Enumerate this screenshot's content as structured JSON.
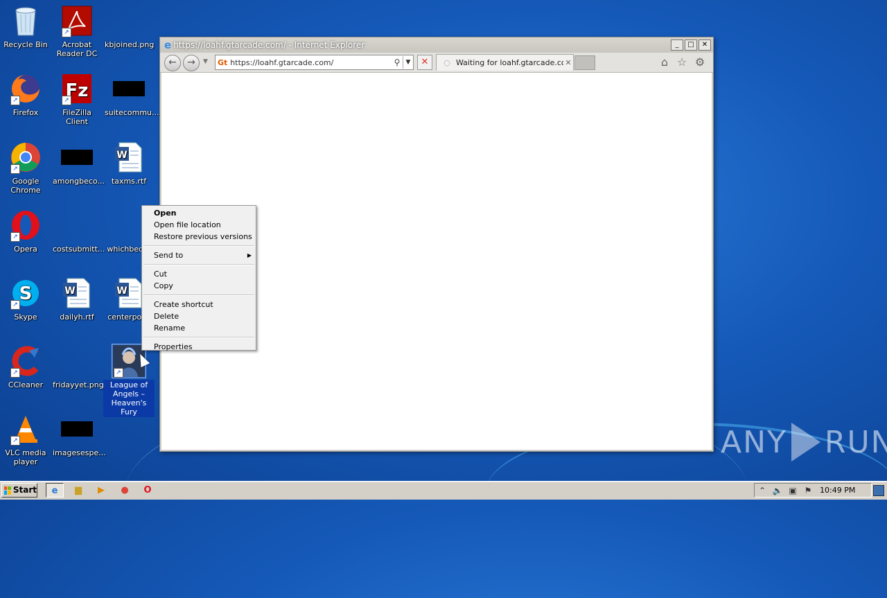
{
  "desktop": {
    "icons": [
      {
        "label": "Recycle Bin",
        "icon": "recycle-bin-icon"
      },
      {
        "label": "Acrobat Reader DC",
        "icon": "acrobat-icon"
      },
      {
        "label": "kbjoined.png",
        "icon": "png-file-icon"
      },
      {
        "label": "Firefox",
        "icon": "firefox-icon"
      },
      {
        "label": "FileZilla Client",
        "icon": "filezilla-icon"
      },
      {
        "label": "suitecommu...",
        "icon": "file-icon"
      },
      {
        "label": "Google Chrome",
        "icon": "chrome-icon"
      },
      {
        "label": "amongbeco...",
        "icon": "file-icon"
      },
      {
        "label": "taxms.rtf",
        "icon": "word-doc-icon"
      },
      {
        "label": "Opera",
        "icon": "opera-icon"
      },
      {
        "label": "costsubmitt...",
        "icon": "file-icon"
      },
      {
        "label": "whichbed.p",
        "icon": "png-file-icon"
      },
      {
        "label": "Skype",
        "icon": "skype-icon"
      },
      {
        "label": "dailyh.rtf",
        "icon": "word-doc-icon"
      },
      {
        "label": "centerpose",
        "icon": "word-doc-icon"
      },
      {
        "label": "CCleaner",
        "icon": "ccleaner-icon"
      },
      {
        "label": "fridayyet.png",
        "icon": "png-file-icon"
      },
      {
        "label": "League of Angels – Heaven's Fury",
        "icon": "game-icon"
      },
      {
        "label": "VLC media player",
        "icon": "vlc-icon"
      },
      {
        "label": "imagesespe...",
        "icon": "file-icon"
      }
    ]
  },
  "ie": {
    "title": "https://loahf.gtarcade.com/ - Internet Explorer",
    "address": "https://loahf.gtarcade.com/",
    "tab_label": "Waiting for loahf.gtarcade.com",
    "win_min": "_",
    "win_max": "□",
    "win_close": "✕"
  },
  "context_menu": {
    "open": "Open",
    "open_file_location": "Open file location",
    "restore_previous_versions": "Restore previous versions",
    "send_to": "Send to",
    "cut": "Cut",
    "copy": "Copy",
    "create_shortcut": "Create shortcut",
    "delete": "Delete",
    "rename": "Rename",
    "properties": "Properties"
  },
  "taskbar": {
    "start_label": "Start",
    "clock": "10:49 PM"
  },
  "watermark": {
    "left": "ANY",
    "right": "RUN"
  },
  "colors": {
    "desktop_bg": "#1559b8",
    "selection": "#0b3aa6",
    "taskbar_bg": "#d4d0c8"
  }
}
